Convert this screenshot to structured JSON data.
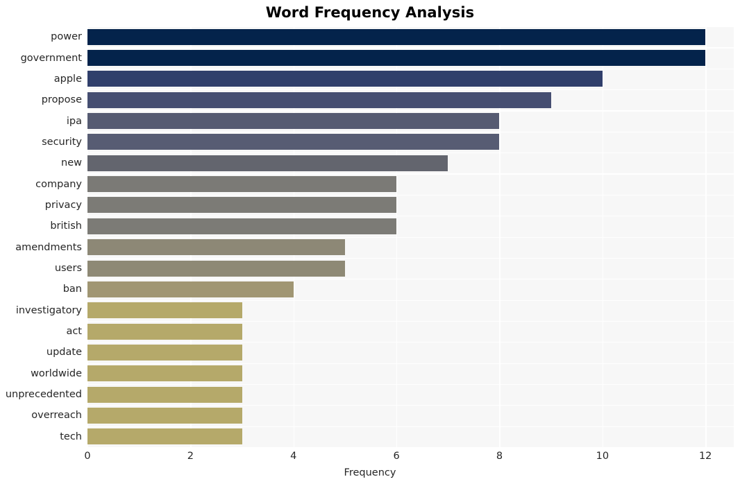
{
  "chart_data": {
    "type": "bar",
    "orientation": "horizontal",
    "title": "Word Frequency Analysis",
    "xlabel": "Frequency",
    "ylabel": "",
    "xlim": [
      0,
      12.55
    ],
    "xticks": [
      0,
      2,
      4,
      6,
      8,
      10,
      12
    ],
    "xtick_labels": [
      "0",
      "2",
      "4",
      "6",
      "8",
      "10",
      "12"
    ],
    "grid": true,
    "grid_color": "#ffffff",
    "plot_background": "#f7f7f7",
    "figure_background": "#ffffff",
    "legend": null,
    "categories": [
      "power",
      "government",
      "apple",
      "propose",
      "ipa",
      "security",
      "new",
      "company",
      "privacy",
      "british",
      "amendments",
      "users",
      "ban",
      "investigatory",
      "act",
      "update",
      "worldwide",
      "unprecedented",
      "overreach",
      "tech"
    ],
    "values": [
      12,
      12,
      10,
      9,
      8,
      8,
      7,
      6,
      6,
      6,
      5,
      5,
      4,
      3,
      3,
      3,
      3,
      3,
      3,
      3
    ],
    "bar_colors": [
      "#04234b",
      "#04234b",
      "#303f6b",
      "#454e71",
      "#565b72",
      "#575c73",
      "#63656e",
      "#7b7a76",
      "#7c7b76",
      "#7c7b76",
      "#8d8876",
      "#8e8975",
      "#a09673",
      "#b5a96a",
      "#b5a96a",
      "#b5a96a",
      "#b5a96a",
      "#b5a96a",
      "#b5a96a",
      "#b5a96a"
    ]
  }
}
